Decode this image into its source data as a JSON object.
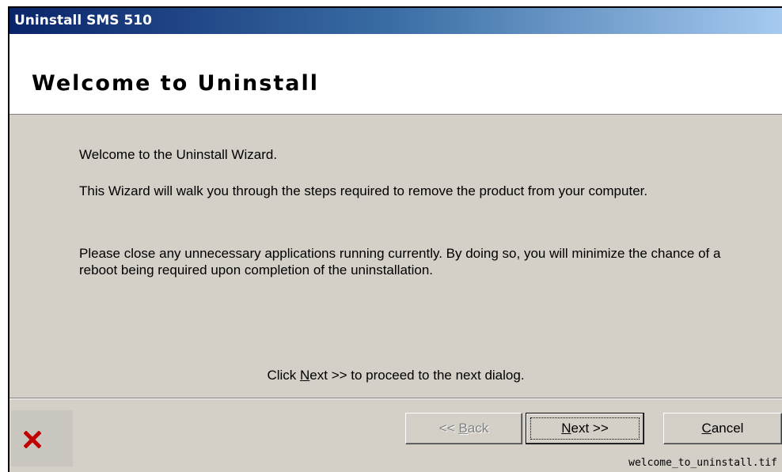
{
  "window": {
    "title": "Uninstall SMS 510"
  },
  "header": {
    "title": "Welcome to Uninstall"
  },
  "content": {
    "welcome": "Welcome to the Uninstall Wizard.",
    "line2": "This Wizard will walk you through the steps required to remove the product from your computer.",
    "line3": "Please close any unnecessary applications running currently. By doing so, you will minimize the chance of a reboot being required upon completion of the uninstallation.",
    "hint_before": "Click ",
    "hint_underline": "N",
    "hint_after_u": "ext >> to proceed to the next dialog."
  },
  "buttons": {
    "back": {
      "prefix": "<< ",
      "underline": "B",
      "rest": "ack"
    },
    "next": {
      "underline": "N",
      "rest": "ext >>"
    },
    "cancel": {
      "underline": "C",
      "rest": "ancel"
    }
  },
  "footer": {
    "filename": "welcome_to_uninstall.tif"
  },
  "icons": {
    "logo": "red-x-icon"
  },
  "colors": {
    "titlebar_start": "#0a246a",
    "titlebar_end": "#a6caf0",
    "dialog_bg": "#d4d0c8",
    "logo_red": "#c00000"
  }
}
